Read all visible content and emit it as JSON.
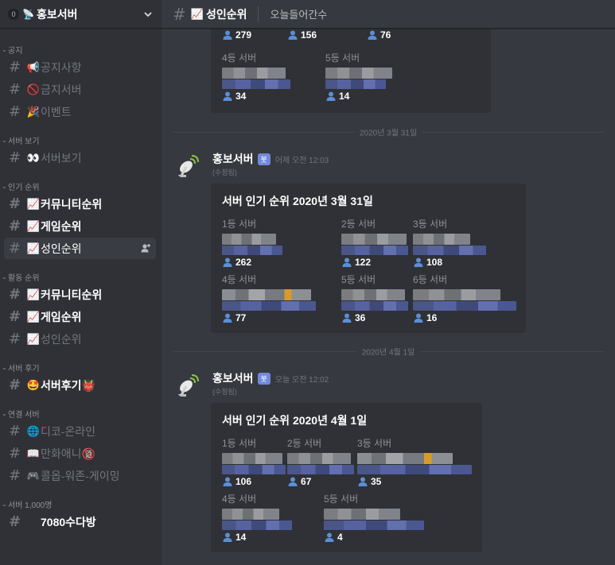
{
  "server": {
    "badge": "0",
    "name": "홍보서버"
  },
  "categories": [
    {
      "name": "공지",
      "channels": [
        {
          "emoji": "📢",
          "label": "공지사항",
          "state": "muted"
        },
        {
          "emoji": "🚫",
          "label": "금지서버",
          "state": "muted"
        },
        {
          "emoji": "🎉",
          "label": "이벤트",
          "state": "muted"
        }
      ]
    },
    {
      "name": "서버 보기",
      "channels": [
        {
          "emoji": "👀",
          "label": "서버보기",
          "state": "muted"
        }
      ]
    },
    {
      "name": "인기 순위",
      "channels": [
        {
          "emoji": "📈",
          "label": "커뮤니티순위",
          "state": "unread"
        },
        {
          "emoji": "📈",
          "label": "게임순위",
          "state": "unread"
        },
        {
          "emoji": "📈",
          "label": "성인순위",
          "state": "active"
        }
      ]
    },
    {
      "name": "활동 순위",
      "channels": [
        {
          "emoji": "📈",
          "label": "커뮤니티순위",
          "state": "unread"
        },
        {
          "emoji": "📈",
          "label": "게임순위",
          "state": "unread"
        },
        {
          "emoji": "📈",
          "label": "성인순위",
          "state": "muted"
        }
      ]
    },
    {
      "name": "서버 후기",
      "channels": [
        {
          "emoji": "🤩",
          "label": "서버후기👹",
          "state": "unread"
        }
      ]
    },
    {
      "name": "연결 서버",
      "channels": [
        {
          "emoji": "🌐",
          "label": "디코-온라인",
          "state": "muted"
        },
        {
          "emoji": "📖",
          "label": "만화애니🔞",
          "state": "muted"
        },
        {
          "emoji": "🎮",
          "label": "콜옵-워존-게이밍",
          "state": "muted"
        }
      ]
    },
    {
      "name": "서버 1,000명",
      "channels": [
        {
          "emoji": "",
          "label": "7080수다방",
          "state": "unread"
        }
      ]
    }
  ],
  "topbar": {
    "channel_emoji": "📈",
    "channel_name": "성인순위",
    "topic": "오늘들어간수"
  },
  "top_embed": {
    "row1_counts": [
      "279",
      "156",
      "76"
    ],
    "row2": [
      {
        "label": "4등 서버",
        "count": "34"
      },
      {
        "label": "5등 서버",
        "count": "14"
      }
    ]
  },
  "dates": [
    "2020년 3월 31일",
    "2020년 4월 1일"
  ],
  "messages": [
    {
      "author": "홍보서버",
      "bot_tag": "봇",
      "time": "어제 오전 12:03",
      "edited": "(수정됨)",
      "embed_title": "서버 인기 순위 2020년 3월 31일",
      "servers": [
        {
          "label": "1등 서버",
          "count": "262"
        },
        {
          "label": "2등 서버",
          "count": "122"
        },
        {
          "label": "3등 서버",
          "count": "108"
        },
        {
          "label": "4등 서버",
          "count": "77"
        },
        {
          "label": "5등 서버",
          "count": "36"
        },
        {
          "label": "6등 서버",
          "count": "16"
        }
      ]
    },
    {
      "author": "홍보서버",
      "bot_tag": "봇",
      "time": "오늘 오전 12:02",
      "edited": "(수정됨)",
      "embed_title": "서버 인기 순위 2020년 4월 1일",
      "servers": [
        {
          "label": "1등 서버",
          "count": "106"
        },
        {
          "label": "2등 서버",
          "count": "67"
        },
        {
          "label": "3등 서버",
          "count": "35"
        },
        {
          "label": "4등 서버",
          "count": "14"
        },
        {
          "label": "5등 서버",
          "count": "4"
        }
      ]
    }
  ],
  "colors": {
    "sidebar": "#2f3136",
    "main": "#36393f",
    "bot_tag": "#7289da",
    "person_icon": "#5b8fd6"
  }
}
